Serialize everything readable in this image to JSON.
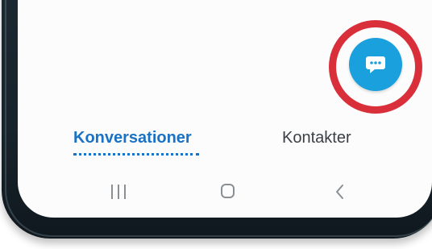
{
  "fab": {
    "icon": "chat-bubble-icon",
    "color": "#1aa0dd",
    "highlight_color": "#d92f3a"
  },
  "tabs": [
    {
      "label": "Konversationer",
      "active": true
    },
    {
      "label": "Kontakter",
      "active": false
    }
  ],
  "tab_colors": {
    "active": "#1a72c4",
    "inactive": "#3a3f44"
  },
  "navigation_bar": {
    "buttons": [
      "recent-apps-icon",
      "home-icon",
      "back-icon"
    ]
  }
}
